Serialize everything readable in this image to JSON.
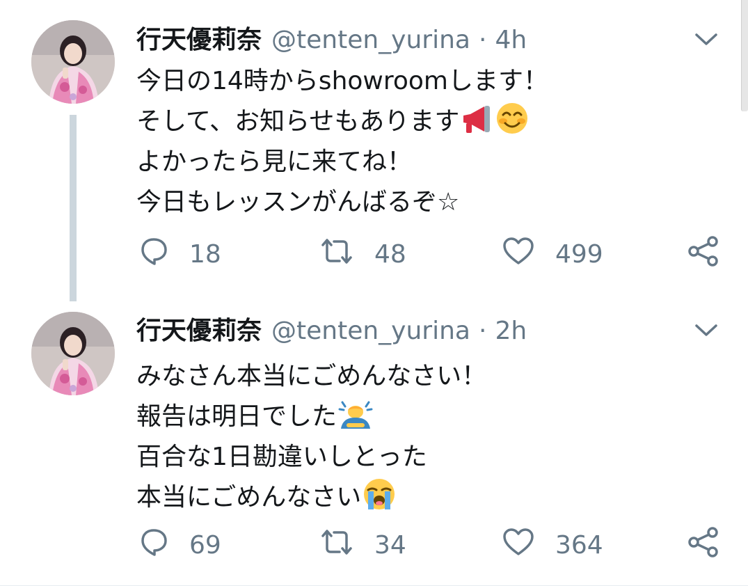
{
  "tweets": [
    {
      "display_name": "行天優莉奈",
      "handle": "@tenten_yurina",
      "separator": "·",
      "time": "4h",
      "lines": [
        "今日の14時からshowroomします！",
        "そして、お知らせもあります",
        "よかったら見に来てね！",
        "今日もレッスンがんばるぞ☆"
      ],
      "emojis": [
        "megaphone-emoji",
        "smiling-face-emoji"
      ],
      "replies": "18",
      "retweets": "48",
      "likes": "499"
    },
    {
      "display_name": "行天優莉奈",
      "handle": "@tenten_yurina",
      "separator": "·",
      "time": "2h",
      "lines": [
        "みなさん本当にごめんなさい！",
        "報告は明日でした",
        "百合な1日勘違いしとった",
        "本当にごめんなさい"
      ],
      "emojis": [
        "bowing-person-emoji",
        "loudly-crying-face-emoji"
      ],
      "replies": "69",
      "retweets": "34",
      "likes": "364"
    }
  ],
  "icons": [
    "reply-icon",
    "retweet-icon",
    "like-icon",
    "share-icon",
    "chevron-down-icon"
  ],
  "colors": {
    "text": "#14171a",
    "secondary": "#657786",
    "thread_line": "#ccd6dd"
  }
}
